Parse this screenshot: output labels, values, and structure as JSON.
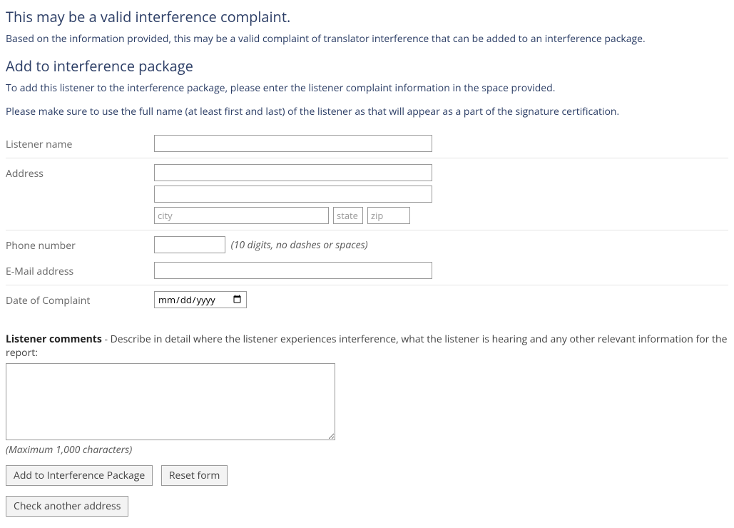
{
  "heading1": "This may be a valid interference complaint.",
  "para1": "Based on the information provided, this may be a valid complaint of translator interference that can be added to an interference package.",
  "heading2": "Add to interference package",
  "para2": "To add this listener to the interference package, please enter the listener complaint information in the space provided.",
  "para3": "Please make sure to use the full name (at least first and last) of the listener as that will appear as a part of the signature certification.",
  "labels": {
    "listener_name": "Listener name",
    "address": "Address",
    "phone": "Phone number",
    "email": "E-Mail address",
    "date": "Date of Complaint"
  },
  "placeholders": {
    "city": "city",
    "state": "state",
    "zip": "zip",
    "date": "mm/dd/yyyy"
  },
  "phone_hint": "(10 digits, no dashes or spaces)",
  "comments": {
    "label_strong": "Listener comments",
    "label_rest": " - Describe in detail where the listener experiences interference, what the listener is hearing and any other relevant information for the report:",
    "max": "(Maximum 1,000 characters)"
  },
  "buttons": {
    "add": "Add to Interference Package",
    "reset": "Reset form",
    "check": "Check another address"
  },
  "values": {
    "listener_name": "",
    "address1": "",
    "address2": "",
    "city": "",
    "state": "",
    "zip": "",
    "phone": "",
    "email": "",
    "date": "",
    "comments": ""
  }
}
